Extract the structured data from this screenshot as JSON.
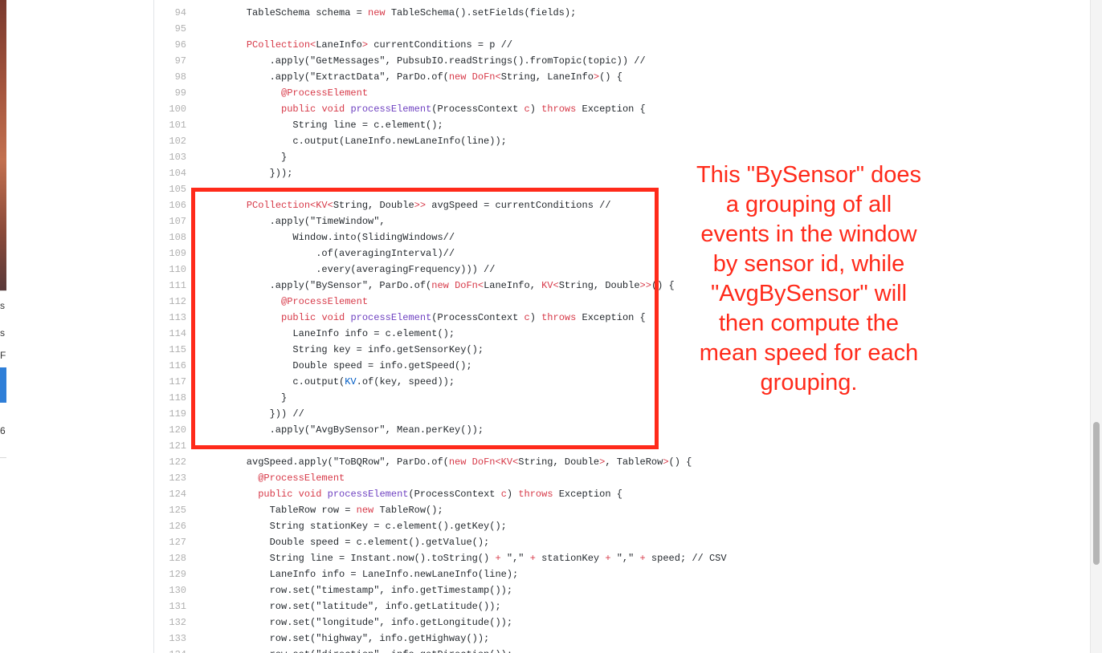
{
  "annotation": {
    "text": "This \"BySensor\" does a grouping of all events in the window by sensor id, while \"AvgBySensor\" will then compute the mean speed for each grouping.",
    "color": "#ff2a1a"
  },
  "left_window": {
    "fragments": [
      "s",
      "s",
      "F",
      "6"
    ]
  },
  "code": {
    "lines": [
      {
        "num": "94",
        "segs": [
          {
            "t": "    TableSchema schema = "
          },
          {
            "t": "new",
            "c": "kw"
          },
          {
            "t": " TableSchema().setFields(fields);"
          }
        ]
      },
      {
        "num": "95",
        "segs": []
      },
      {
        "num": "96",
        "segs": [
          {
            "t": "    "
          },
          {
            "t": "PCollection<",
            "c": "kw"
          },
          {
            "t": "LaneInfo"
          },
          {
            "t": ">",
            "c": "kw"
          },
          {
            "t": " currentConditions = p //"
          }
        ]
      },
      {
        "num": "97",
        "segs": [
          {
            "t": "        .apply(\"GetMessages\", PubsubIO.readStrings().fromTopic(topic)) //"
          }
        ]
      },
      {
        "num": "98",
        "segs": [
          {
            "t": "        .apply(\"ExtractData\", ParDo.of("
          },
          {
            "t": "new",
            "c": "kw"
          },
          {
            "t": " "
          },
          {
            "t": "DoFn<",
            "c": "kw"
          },
          {
            "t": "String, LaneInfo"
          },
          {
            "t": ">",
            "c": "kw"
          },
          {
            "t": "() {"
          }
        ]
      },
      {
        "num": "99",
        "segs": [
          {
            "t": "          "
          },
          {
            "t": "@ProcessElement",
            "c": "an"
          }
        ]
      },
      {
        "num": "100",
        "segs": [
          {
            "t": "          "
          },
          {
            "t": "public",
            "c": "kw"
          },
          {
            "t": " "
          },
          {
            "t": "void",
            "c": "kw"
          },
          {
            "t": " "
          },
          {
            "t": "processElement",
            "c": "fn"
          },
          {
            "t": "(ProcessContext "
          },
          {
            "t": "c",
            "c": "kw"
          },
          {
            "t": ") "
          },
          {
            "t": "throws",
            "c": "kw"
          },
          {
            "t": " Exception {"
          }
        ]
      },
      {
        "num": "101",
        "segs": [
          {
            "t": "            String line = c.element();"
          }
        ]
      },
      {
        "num": "102",
        "segs": [
          {
            "t": "            c.output(LaneInfo.newLaneInfo(line));"
          }
        ]
      },
      {
        "num": "103",
        "segs": [
          {
            "t": "          }"
          }
        ]
      },
      {
        "num": "104",
        "segs": [
          {
            "t": "        }));"
          }
        ]
      },
      {
        "num": "105",
        "segs": []
      },
      {
        "num": "106",
        "segs": [
          {
            "t": "    "
          },
          {
            "t": "PCollection<KV<",
            "c": "kw"
          },
          {
            "t": "String, Double"
          },
          {
            "t": ">>",
            "c": "kw"
          },
          {
            "t": " avgSpeed = currentConditions //"
          }
        ]
      },
      {
        "num": "107",
        "segs": [
          {
            "t": "        .apply(\"TimeWindow\","
          }
        ]
      },
      {
        "num": "108",
        "segs": [
          {
            "t": "            Window.into(SlidingWindows//"
          }
        ]
      },
      {
        "num": "109",
        "segs": [
          {
            "t": "                .of(averagingInterval)//"
          }
        ]
      },
      {
        "num": "110",
        "segs": [
          {
            "t": "                .every(averagingFrequency))) //"
          }
        ]
      },
      {
        "num": "111",
        "segs": [
          {
            "t": "        .apply(\"BySensor\", ParDo.of("
          },
          {
            "t": "new",
            "c": "kw"
          },
          {
            "t": " "
          },
          {
            "t": "DoFn<",
            "c": "kw"
          },
          {
            "t": "LaneInfo, "
          },
          {
            "t": "KV<",
            "c": "kw"
          },
          {
            "t": "String, Double"
          },
          {
            "t": ">>",
            "c": "kw"
          },
          {
            "t": "() {"
          }
        ]
      },
      {
        "num": "112",
        "segs": [
          {
            "t": "          "
          },
          {
            "t": "@ProcessElement",
            "c": "an"
          }
        ]
      },
      {
        "num": "113",
        "segs": [
          {
            "t": "          "
          },
          {
            "t": "public",
            "c": "kw"
          },
          {
            "t": " "
          },
          {
            "t": "void",
            "c": "kw"
          },
          {
            "t": " "
          },
          {
            "t": "processElement",
            "c": "fn"
          },
          {
            "t": "(ProcessContext "
          },
          {
            "t": "c",
            "c": "kw"
          },
          {
            "t": ") "
          },
          {
            "t": "throws",
            "c": "kw"
          },
          {
            "t": " Exception {"
          }
        ]
      },
      {
        "num": "114",
        "segs": [
          {
            "t": "            LaneInfo info = c.element();"
          }
        ]
      },
      {
        "num": "115",
        "segs": [
          {
            "t": "            String key = info.getSensorKey();"
          }
        ]
      },
      {
        "num": "116",
        "segs": [
          {
            "t": "            Double speed = info.getSpeed();"
          }
        ]
      },
      {
        "num": "117",
        "segs": [
          {
            "t": "            c.output("
          },
          {
            "t": "KV",
            "c": "cn"
          },
          {
            "t": ".of(key, speed));"
          }
        ]
      },
      {
        "num": "118",
        "segs": [
          {
            "t": "          }"
          }
        ]
      },
      {
        "num": "119",
        "segs": [
          {
            "t": "        })) //"
          }
        ]
      },
      {
        "num": "120",
        "segs": [
          {
            "t": "        .apply(\"AvgBySensor\", Mean.perKey());"
          }
        ]
      },
      {
        "num": "121",
        "segs": []
      },
      {
        "num": "122",
        "segs": [
          {
            "t": "    avgSpeed.apply(\"ToBQRow\", ParDo.of("
          },
          {
            "t": "new",
            "c": "kw"
          },
          {
            "t": " "
          },
          {
            "t": "DoFn<KV<",
            "c": "kw"
          },
          {
            "t": "String, Double"
          },
          {
            "t": ">",
            "c": "kw"
          },
          {
            "t": ", TableRow"
          },
          {
            "t": ">",
            "c": "kw"
          },
          {
            "t": "() {"
          }
        ]
      },
      {
        "num": "123",
        "segs": [
          {
            "t": "      "
          },
          {
            "t": "@ProcessElement",
            "c": "an"
          }
        ]
      },
      {
        "num": "124",
        "segs": [
          {
            "t": "      "
          },
          {
            "t": "public",
            "c": "kw"
          },
          {
            "t": " "
          },
          {
            "t": "void",
            "c": "kw"
          },
          {
            "t": " "
          },
          {
            "t": "processElement",
            "c": "fn"
          },
          {
            "t": "(ProcessContext "
          },
          {
            "t": "c",
            "c": "kw"
          },
          {
            "t": ") "
          },
          {
            "t": "throws",
            "c": "kw"
          },
          {
            "t": " Exception {"
          }
        ]
      },
      {
        "num": "125",
        "segs": [
          {
            "t": "        TableRow row = "
          },
          {
            "t": "new",
            "c": "kw"
          },
          {
            "t": " TableRow();"
          }
        ]
      },
      {
        "num": "126",
        "segs": [
          {
            "t": "        String stationKey = c.element().getKey();"
          }
        ]
      },
      {
        "num": "127",
        "segs": [
          {
            "t": "        Double speed = c.element().getValue();"
          }
        ]
      },
      {
        "num": "128",
        "segs": [
          {
            "t": "        String line = Instant.now().toString() "
          },
          {
            "t": "+",
            "c": "kw"
          },
          {
            "t": " \",\" "
          },
          {
            "t": "+",
            "c": "kw"
          },
          {
            "t": " stationKey "
          },
          {
            "t": "+",
            "c": "kw"
          },
          {
            "t": " \",\" "
          },
          {
            "t": "+",
            "c": "kw"
          },
          {
            "t": " speed; // CSV"
          }
        ]
      },
      {
        "num": "129",
        "segs": [
          {
            "t": "        LaneInfo info = LaneInfo.newLaneInfo(line);"
          }
        ]
      },
      {
        "num": "130",
        "segs": [
          {
            "t": "        row.set(\"timestamp\", info.getTimestamp());"
          }
        ]
      },
      {
        "num": "131",
        "segs": [
          {
            "t": "        row.set(\"latitude\", info.getLatitude());"
          }
        ]
      },
      {
        "num": "132",
        "segs": [
          {
            "t": "        row.set(\"longitude\", info.getLongitude());"
          }
        ]
      },
      {
        "num": "133",
        "segs": [
          {
            "t": "        row.set(\"highway\", info.getHighway());"
          }
        ]
      },
      {
        "num": "134",
        "segs": [
          {
            "t": "        row.set(\"direction\", info.getDirection());"
          }
        ]
      }
    ]
  }
}
